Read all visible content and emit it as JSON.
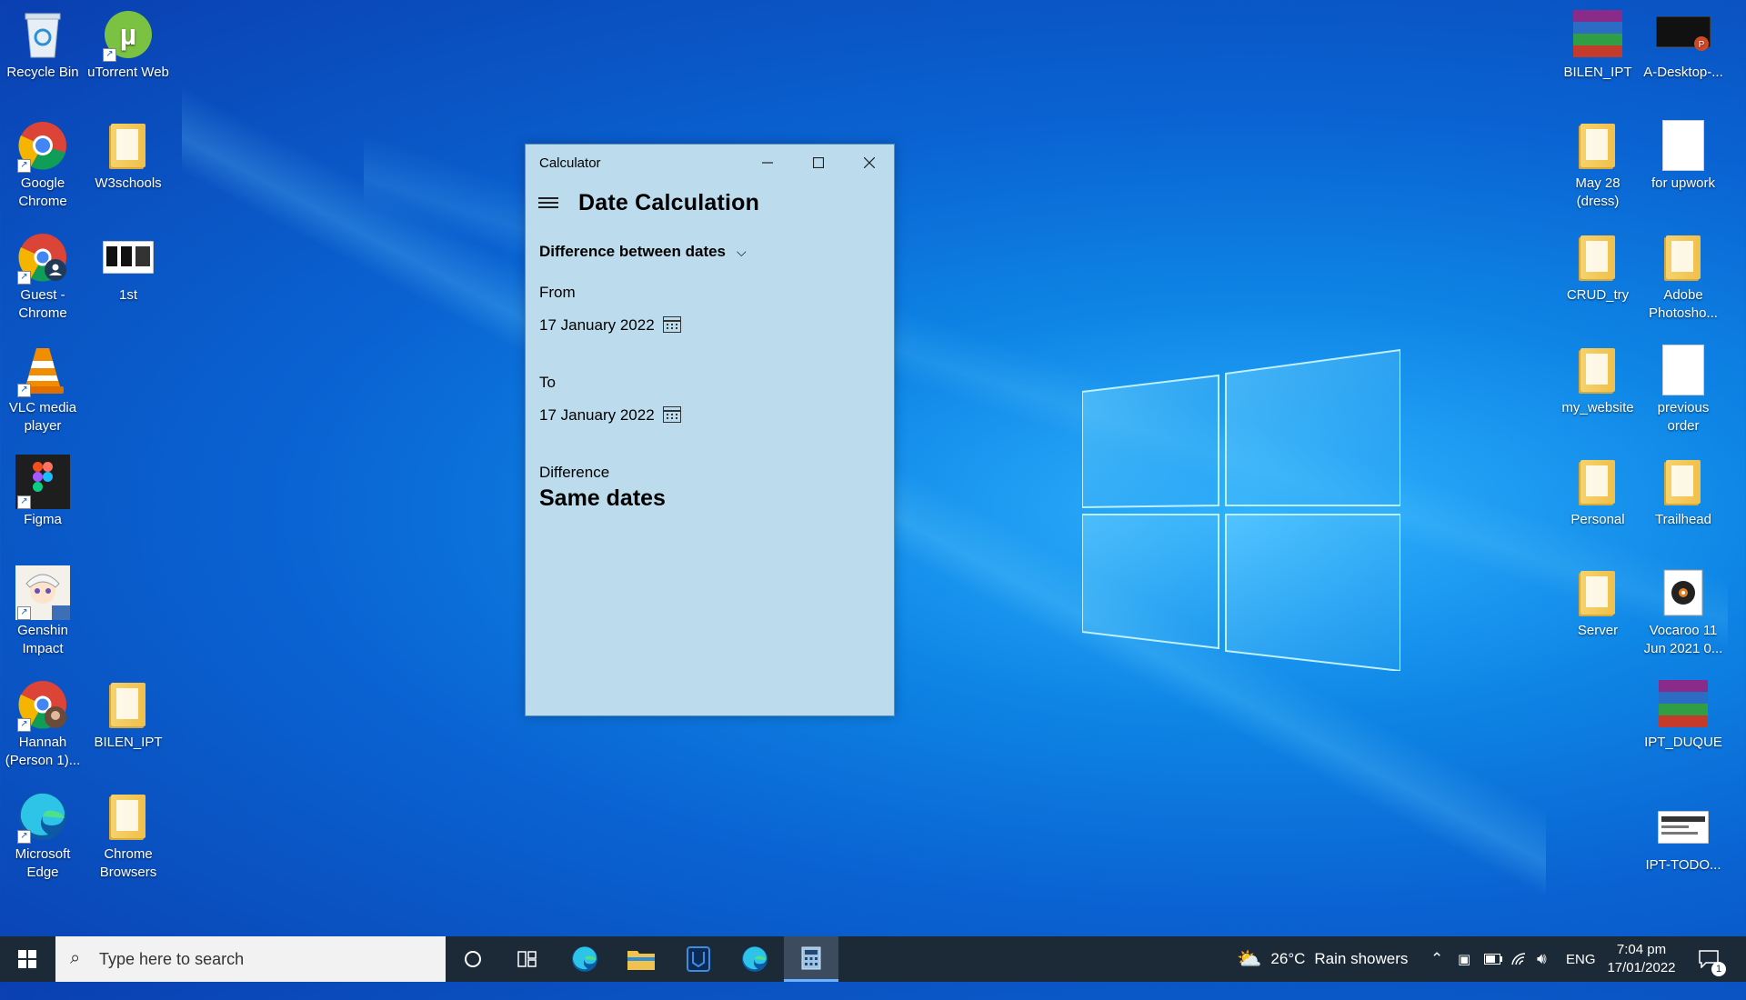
{
  "desktop": {
    "left_icons": [
      {
        "label": "Recycle Bin",
        "icon": "recycle-bin-icon"
      },
      {
        "label": "uTorrent Web",
        "icon": "utorrent-icon"
      },
      {
        "label": "Google Chrome",
        "icon": "chrome-icon"
      },
      {
        "label": "W3schools",
        "icon": "folder-icon"
      },
      {
        "label": "Guest - Chrome",
        "icon": "chrome-profile-icon"
      },
      {
        "label": "1st",
        "icon": "screenshot-file-icon"
      },
      {
        "label": "VLC media player",
        "icon": "vlc-icon"
      },
      {
        "label": "Figma",
        "icon": "figma-icon"
      },
      {
        "label": "Genshin Impact",
        "icon": "genshin-icon"
      },
      {
        "label": "Hannah (Person 1)...",
        "icon": "chrome-profile-icon"
      },
      {
        "label": "BILEN_IPT",
        "icon": "folder-icon"
      },
      {
        "label": "Microsoft Edge",
        "icon": "edge-icon"
      },
      {
        "label": "Chrome Browsers",
        "icon": "folder-icon"
      }
    ],
    "right_icons": [
      {
        "label": "BILEN_IPT",
        "icon": "winrar-icon"
      },
      {
        "label": "A-Desktop-...",
        "icon": "powerpoint-file-icon"
      },
      {
        "label": "May 28 (dress)",
        "icon": "folder-icon"
      },
      {
        "label": "for upwork",
        "icon": "document-icon"
      },
      {
        "label": "CRUD_try",
        "icon": "folder-icon"
      },
      {
        "label": "Adobe Photosho...",
        "icon": "folder-icon"
      },
      {
        "label": "my_website",
        "icon": "folder-icon"
      },
      {
        "label": "previous order",
        "icon": "document-icon"
      },
      {
        "label": "Personal",
        "icon": "folder-icon"
      },
      {
        "label": "Trailhead",
        "icon": "folder-icon"
      },
      {
        "label": "Server",
        "icon": "folder-icon"
      },
      {
        "label": "Vocaroo 11 Jun 2021 0...",
        "icon": "audio-file-icon"
      },
      {
        "label": "IPT_DUQUE",
        "icon": "winrar-icon"
      },
      {
        "label": "IPT-TODO...",
        "icon": "screenshot-file-icon"
      }
    ]
  },
  "calculator": {
    "window_title": "Calculator",
    "heading": "Date Calculation",
    "mode": "Difference between dates",
    "from_label": "From",
    "from_date": "17 January 2022",
    "to_label": "To",
    "to_date": "17 January 2022",
    "difference_label": "Difference",
    "difference_value": "Same dates"
  },
  "taskbar": {
    "search_placeholder": "Type here to search",
    "weather_temp": "26°C",
    "weather_text": "Rain showers",
    "language": "ENG",
    "time": "7:04 pm",
    "date": "17/01/2022",
    "notification_count": "1"
  },
  "colors": {
    "calculator_bg": "#bcdcee",
    "taskbar_bg": "#1c2a38",
    "desktop_blue": "#0a63d2"
  }
}
